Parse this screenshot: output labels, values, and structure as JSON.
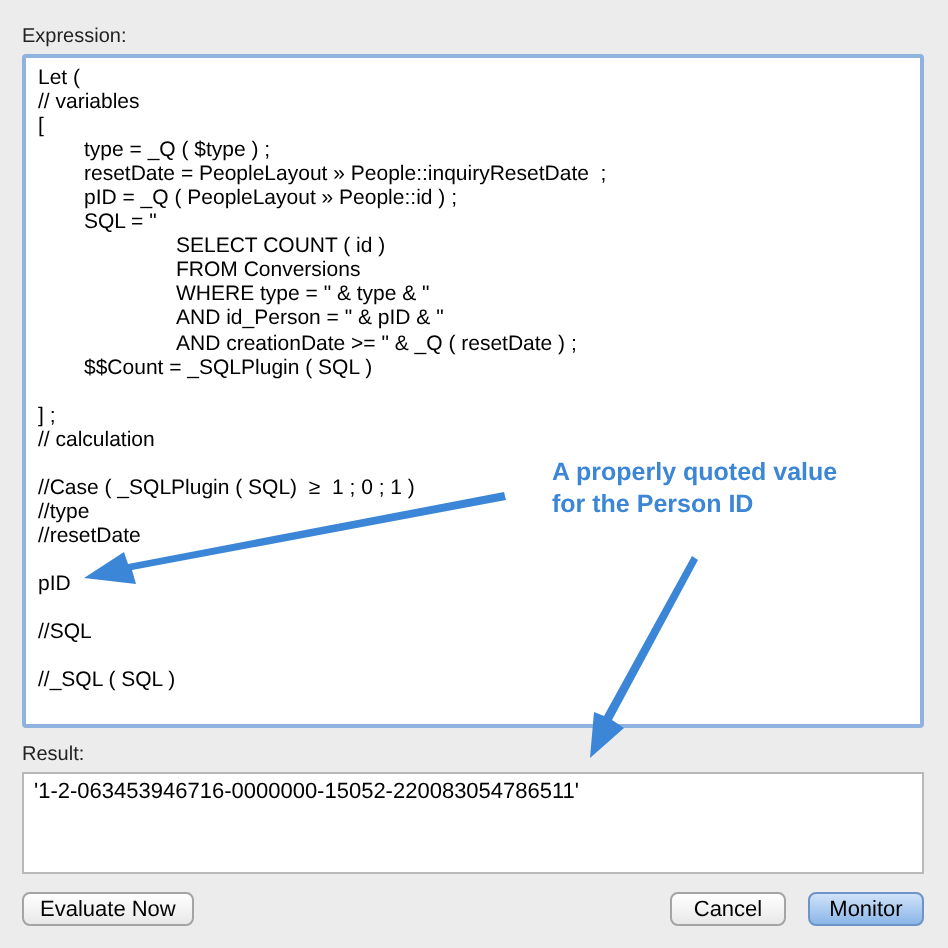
{
  "expression": {
    "label": "Expression:",
    "value": "Let (\n// variables\n[\n\ttype = _Q ( $type ) ;\n\tresetDate = PeopleLayout » People::inquiryResetDate  ;\n\tpID = _Q ( PeopleLayout » People::id ) ;\n\tSQL = \"\n\t\t\tSELECT COUNT ( id )\n\t\t\tFROM Conversions\n\t\t\tWHERE type = \" & type & \"\n\t\t\tAND id_Person = \" & pID & \"\n\t\t\tAND creationDate >= \" & _Q ( resetDate ) ;\n\t$$Count = _SQLPlugin ( SQL )\n\n] ;\n// calculation\n\n//Case ( _SQLPlugin ( SQL)  ≥  1 ; 0 ; 1 )\n//type\n//resetDate\n\npID\n\n//SQL\n\n//_SQL ( SQL )"
  },
  "result": {
    "label": "Result:",
    "value": "'1-2-063453946716-0000000-15052-220083054786511'"
  },
  "buttons": [
    {
      "label": "Evaluate Now",
      "default": false
    },
    {
      "label": "Cancel",
      "default": false
    },
    {
      "label": "Monitor",
      "default": true
    }
  ],
  "annotation": {
    "text": "A properly quoted value for the Person ID"
  }
}
